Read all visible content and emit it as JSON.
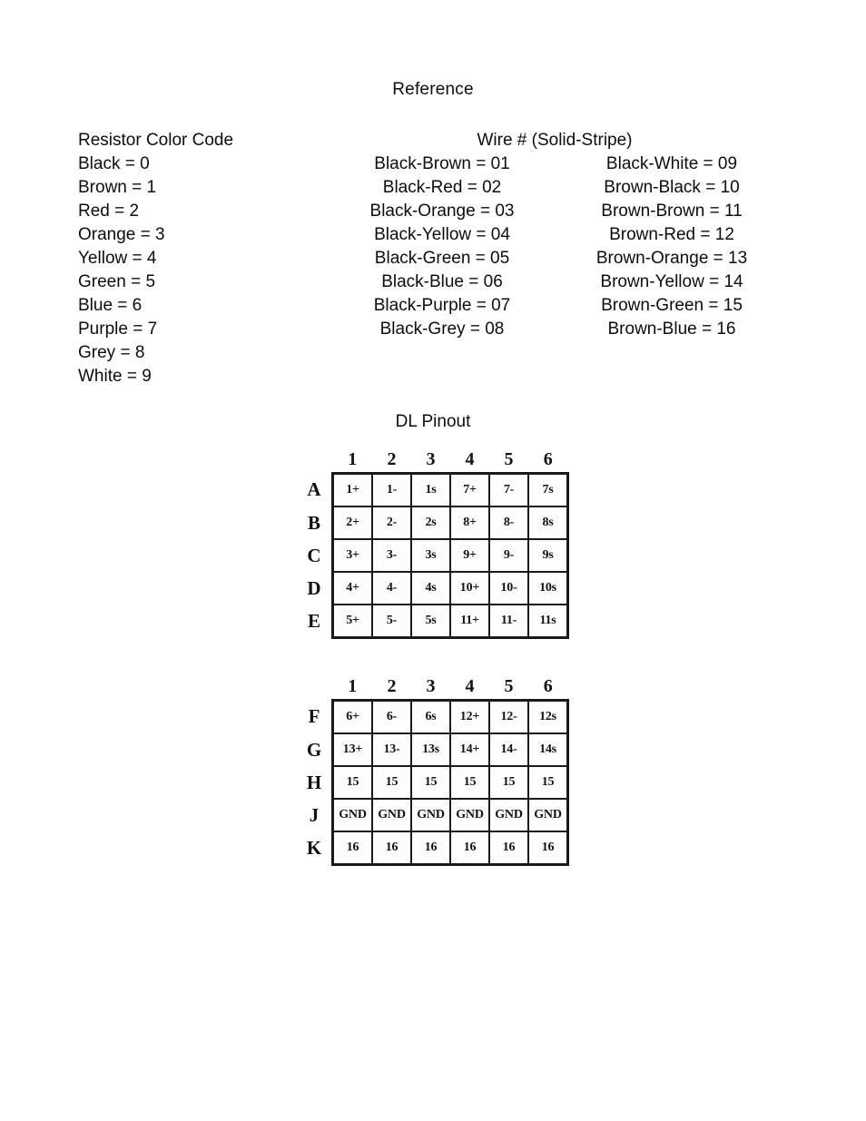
{
  "document": {
    "title": "Reference"
  },
  "resistor_section": {
    "heading": "Resistor Color Code",
    "entries": [
      "Black  =  0",
      "Brown  =  1",
      "Red  =  2",
      "Orange  =  3",
      "Yellow  =  4",
      "Green  =  5",
      "Blue  =  6",
      "Purple  =  7",
      "Grey  =  8",
      "White  =  9"
    ]
  },
  "wire_section": {
    "heading": "Wire # (Solid-Stripe)",
    "column_left": [
      "Black-Brown  =  01",
      "Black-Red  =  02",
      "Black-Orange  =  03",
      "Black-Yellow  =  04",
      "Black-Green  =  05",
      "Black-Blue  =  06",
      "Black-Purple  =  07",
      "Black-Grey  =  08"
    ],
    "column_right": [
      "Black-White  =  09",
      "Brown-Black  =  10",
      "Brown-Brown  =  11",
      "Brown-Red  =  12",
      "Brown-Orange  =  13",
      "Brown-Yellow  =  14",
      "Brown-Green  =  15",
      "Brown-Blue  =  16"
    ]
  },
  "pinout_section": {
    "heading": "DL Pinout",
    "tables": [
      {
        "name": "pinout-table-a-e",
        "columns": [
          "1",
          "2",
          "3",
          "4",
          "5",
          "6"
        ],
        "rows": [
          {
            "label": "A",
            "cells": [
              "1+",
              "1-",
              "1s",
              "7+",
              "7-",
              "7s"
            ]
          },
          {
            "label": "B",
            "cells": [
              "2+",
              "2-",
              "2s",
              "8+",
              "8-",
              "8s"
            ]
          },
          {
            "label": "C",
            "cells": [
              "3+",
              "3-",
              "3s",
              "9+",
              "9-",
              "9s"
            ]
          },
          {
            "label": "D",
            "cells": [
              "4+",
              "4-",
              "4s",
              "10+",
              "10-",
              "10s"
            ]
          },
          {
            "label": "E",
            "cells": [
              "5+",
              "5-",
              "5s",
              "11+",
              "11-",
              "11s"
            ]
          }
        ]
      },
      {
        "name": "pinout-table-f-k",
        "columns": [
          "1",
          "2",
          "3",
          "4",
          "5",
          "6"
        ],
        "rows": [
          {
            "label": "F",
            "cells": [
              "6+",
              "6-",
              "6s",
              "12+",
              "12-",
              "12s"
            ]
          },
          {
            "label": "G",
            "cells": [
              "13+",
              "13-",
              "13s",
              "14+",
              "14-",
              "14s"
            ]
          },
          {
            "label": "H",
            "cells": [
              "15",
              "15",
              "15",
              "15",
              "15",
              "15"
            ]
          },
          {
            "label": "J",
            "cells": [
              "GND",
              "GND",
              "GND",
              "GND",
              "GND",
              "GND"
            ]
          },
          {
            "label": "K",
            "cells": [
              "16",
              "16",
              "16",
              "16",
              "16",
              "16"
            ]
          }
        ]
      }
    ]
  },
  "colors": {
    "page_background": "#ffffff",
    "text": "#0d0d0d",
    "table_border": "#1a1a1a"
  }
}
